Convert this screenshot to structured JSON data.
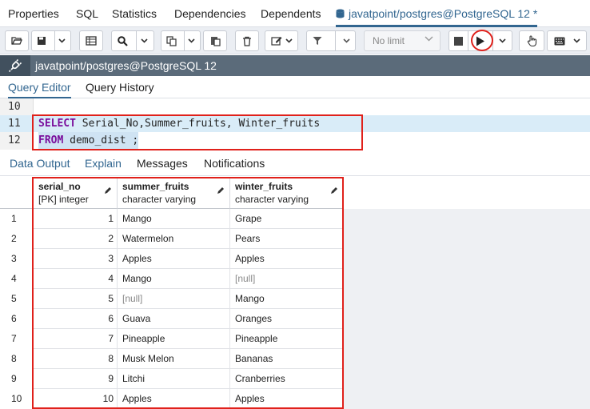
{
  "top_tabs": [
    {
      "label": "Properties"
    },
    {
      "label": "SQL"
    },
    {
      "label": "Statistics"
    },
    {
      "label": "Dependencies"
    },
    {
      "label": "Dependents"
    },
    {
      "label": "javatpoint/postgres@PostgreSQL 12 *"
    }
  ],
  "toolbar": {
    "limit_select": "No limit"
  },
  "connection": {
    "label": "javatpoint/postgres@PostgreSQL 12"
  },
  "editor_tabs": [
    {
      "label": "Query Editor"
    },
    {
      "label": "Query History"
    }
  ],
  "editor": {
    "lines": [
      {
        "number": "10",
        "keyword": "",
        "text": ""
      },
      {
        "number": "11",
        "keyword": "SELECT",
        "text": " Serial_No,Summer_fruits, Winter_fruits"
      },
      {
        "number": "12",
        "keyword": "FROM",
        "text": " demo_dist ;"
      }
    ]
  },
  "result_tabs": [
    {
      "label": "Data Output"
    },
    {
      "label": "Explain"
    },
    {
      "label": "Messages"
    },
    {
      "label": "Notifications"
    }
  ],
  "grid": {
    "columns": [
      {
        "name": "serial_no",
        "type": "[PK] integer"
      },
      {
        "name": "summer_fruits",
        "type": "character varying"
      },
      {
        "name": "winter_fruits",
        "type": "character varying"
      }
    ],
    "rows": [
      {
        "index": "1",
        "serial_no": "1",
        "summer_fruits": "Mango",
        "winter_fruits": "Grape"
      },
      {
        "index": "2",
        "serial_no": "2",
        "summer_fruits": "Watermelon",
        "winter_fruits": "Pears"
      },
      {
        "index": "3",
        "serial_no": "3",
        "summer_fruits": "Apples",
        "winter_fruits": "Apples"
      },
      {
        "index": "4",
        "serial_no": "4",
        "summer_fruits": "Mango",
        "winter_fruits": "[null]"
      },
      {
        "index": "5",
        "serial_no": "5",
        "summer_fruits": "[null]",
        "winter_fruits": "Mango"
      },
      {
        "index": "6",
        "serial_no": "6",
        "summer_fruits": "Guava",
        "winter_fruits": "Oranges"
      },
      {
        "index": "7",
        "serial_no": "7",
        "summer_fruits": "Pineapple",
        "winter_fruits": "Pineapple"
      },
      {
        "index": "8",
        "serial_no": "8",
        "summer_fruits": "Musk Melon",
        "winter_fruits": " Bananas"
      },
      {
        "index": "9",
        "serial_no": "9",
        "summer_fruits": "Litchi",
        "winter_fruits": "Cranberries"
      },
      {
        "index": "10",
        "serial_no": "10",
        "summer_fruits": "Apples",
        "winter_fruits": "Apples"
      }
    ]
  },
  "colors": {
    "accent": "#326690",
    "annotation": "#e0211b",
    "keyword": "#7a0e9c",
    "connection_bar": "#5b6b7a"
  }
}
